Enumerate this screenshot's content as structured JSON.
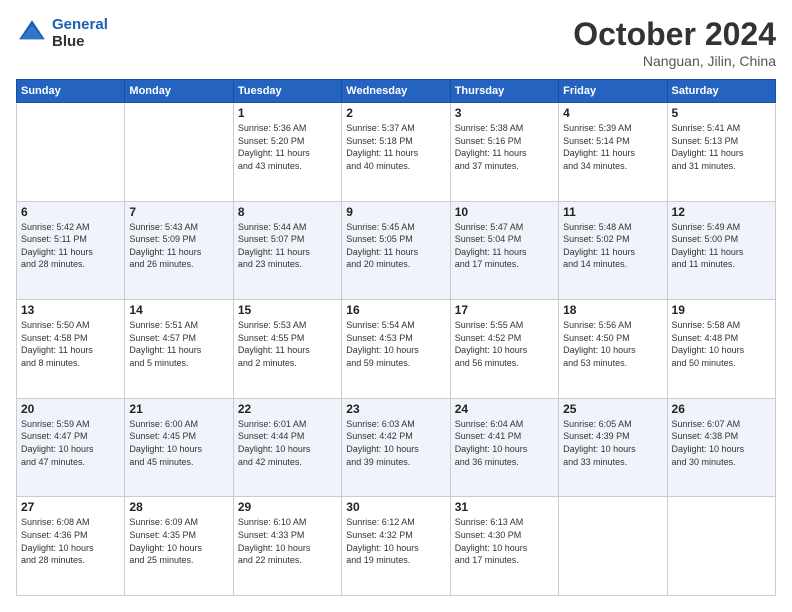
{
  "logo": {
    "line1": "General",
    "line2": "Blue"
  },
  "header": {
    "month_year": "October 2024",
    "location": "Nanguan, Jilin, China"
  },
  "days_of_week": [
    "Sunday",
    "Monday",
    "Tuesday",
    "Wednesday",
    "Thursday",
    "Friday",
    "Saturday"
  ],
  "weeks": [
    [
      {
        "day": "",
        "detail": ""
      },
      {
        "day": "",
        "detail": ""
      },
      {
        "day": "1",
        "detail": "Sunrise: 5:36 AM\nSunset: 5:20 PM\nDaylight: 11 hours\nand 43 minutes."
      },
      {
        "day": "2",
        "detail": "Sunrise: 5:37 AM\nSunset: 5:18 PM\nDaylight: 11 hours\nand 40 minutes."
      },
      {
        "day": "3",
        "detail": "Sunrise: 5:38 AM\nSunset: 5:16 PM\nDaylight: 11 hours\nand 37 minutes."
      },
      {
        "day": "4",
        "detail": "Sunrise: 5:39 AM\nSunset: 5:14 PM\nDaylight: 11 hours\nand 34 minutes."
      },
      {
        "day": "5",
        "detail": "Sunrise: 5:41 AM\nSunset: 5:13 PM\nDaylight: 11 hours\nand 31 minutes."
      }
    ],
    [
      {
        "day": "6",
        "detail": "Sunrise: 5:42 AM\nSunset: 5:11 PM\nDaylight: 11 hours\nand 28 minutes."
      },
      {
        "day": "7",
        "detail": "Sunrise: 5:43 AM\nSunset: 5:09 PM\nDaylight: 11 hours\nand 26 minutes."
      },
      {
        "day": "8",
        "detail": "Sunrise: 5:44 AM\nSunset: 5:07 PM\nDaylight: 11 hours\nand 23 minutes."
      },
      {
        "day": "9",
        "detail": "Sunrise: 5:45 AM\nSunset: 5:05 PM\nDaylight: 11 hours\nand 20 minutes."
      },
      {
        "day": "10",
        "detail": "Sunrise: 5:47 AM\nSunset: 5:04 PM\nDaylight: 11 hours\nand 17 minutes."
      },
      {
        "day": "11",
        "detail": "Sunrise: 5:48 AM\nSunset: 5:02 PM\nDaylight: 11 hours\nand 14 minutes."
      },
      {
        "day": "12",
        "detail": "Sunrise: 5:49 AM\nSunset: 5:00 PM\nDaylight: 11 hours\nand 11 minutes."
      }
    ],
    [
      {
        "day": "13",
        "detail": "Sunrise: 5:50 AM\nSunset: 4:58 PM\nDaylight: 11 hours\nand 8 minutes."
      },
      {
        "day": "14",
        "detail": "Sunrise: 5:51 AM\nSunset: 4:57 PM\nDaylight: 11 hours\nand 5 minutes."
      },
      {
        "day": "15",
        "detail": "Sunrise: 5:53 AM\nSunset: 4:55 PM\nDaylight: 11 hours\nand 2 minutes."
      },
      {
        "day": "16",
        "detail": "Sunrise: 5:54 AM\nSunset: 4:53 PM\nDaylight: 10 hours\nand 59 minutes."
      },
      {
        "day": "17",
        "detail": "Sunrise: 5:55 AM\nSunset: 4:52 PM\nDaylight: 10 hours\nand 56 minutes."
      },
      {
        "day": "18",
        "detail": "Sunrise: 5:56 AM\nSunset: 4:50 PM\nDaylight: 10 hours\nand 53 minutes."
      },
      {
        "day": "19",
        "detail": "Sunrise: 5:58 AM\nSunset: 4:48 PM\nDaylight: 10 hours\nand 50 minutes."
      }
    ],
    [
      {
        "day": "20",
        "detail": "Sunrise: 5:59 AM\nSunset: 4:47 PM\nDaylight: 10 hours\nand 47 minutes."
      },
      {
        "day": "21",
        "detail": "Sunrise: 6:00 AM\nSunset: 4:45 PM\nDaylight: 10 hours\nand 45 minutes."
      },
      {
        "day": "22",
        "detail": "Sunrise: 6:01 AM\nSunset: 4:44 PM\nDaylight: 10 hours\nand 42 minutes."
      },
      {
        "day": "23",
        "detail": "Sunrise: 6:03 AM\nSunset: 4:42 PM\nDaylight: 10 hours\nand 39 minutes."
      },
      {
        "day": "24",
        "detail": "Sunrise: 6:04 AM\nSunset: 4:41 PM\nDaylight: 10 hours\nand 36 minutes."
      },
      {
        "day": "25",
        "detail": "Sunrise: 6:05 AM\nSunset: 4:39 PM\nDaylight: 10 hours\nand 33 minutes."
      },
      {
        "day": "26",
        "detail": "Sunrise: 6:07 AM\nSunset: 4:38 PM\nDaylight: 10 hours\nand 30 minutes."
      }
    ],
    [
      {
        "day": "27",
        "detail": "Sunrise: 6:08 AM\nSunset: 4:36 PM\nDaylight: 10 hours\nand 28 minutes."
      },
      {
        "day": "28",
        "detail": "Sunrise: 6:09 AM\nSunset: 4:35 PM\nDaylight: 10 hours\nand 25 minutes."
      },
      {
        "day": "29",
        "detail": "Sunrise: 6:10 AM\nSunset: 4:33 PM\nDaylight: 10 hours\nand 22 minutes."
      },
      {
        "day": "30",
        "detail": "Sunrise: 6:12 AM\nSunset: 4:32 PM\nDaylight: 10 hours\nand 19 minutes."
      },
      {
        "day": "31",
        "detail": "Sunrise: 6:13 AM\nSunset: 4:30 PM\nDaylight: 10 hours\nand 17 minutes."
      },
      {
        "day": "",
        "detail": ""
      },
      {
        "day": "",
        "detail": ""
      }
    ]
  ]
}
